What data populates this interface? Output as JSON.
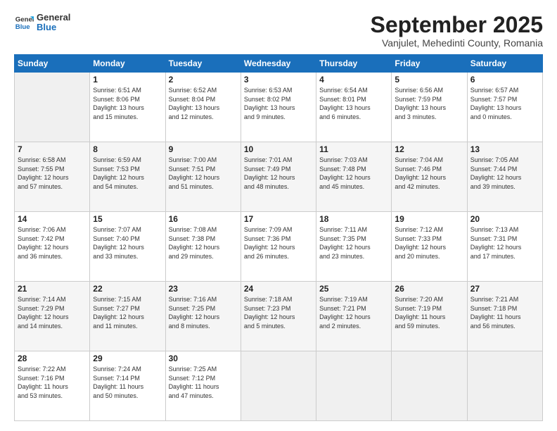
{
  "header": {
    "logo_line1": "General",
    "logo_line2": "Blue",
    "month": "September 2025",
    "location": "Vanjulet, Mehedinti County, Romania"
  },
  "days_of_week": [
    "Sunday",
    "Monday",
    "Tuesday",
    "Wednesday",
    "Thursday",
    "Friday",
    "Saturday"
  ],
  "weeks": [
    [
      {
        "day": "",
        "info": ""
      },
      {
        "day": "1",
        "info": "Sunrise: 6:51 AM\nSunset: 8:06 PM\nDaylight: 13 hours\nand 15 minutes."
      },
      {
        "day": "2",
        "info": "Sunrise: 6:52 AM\nSunset: 8:04 PM\nDaylight: 13 hours\nand 12 minutes."
      },
      {
        "day": "3",
        "info": "Sunrise: 6:53 AM\nSunset: 8:02 PM\nDaylight: 13 hours\nand 9 minutes."
      },
      {
        "day": "4",
        "info": "Sunrise: 6:54 AM\nSunset: 8:01 PM\nDaylight: 13 hours\nand 6 minutes."
      },
      {
        "day": "5",
        "info": "Sunrise: 6:56 AM\nSunset: 7:59 PM\nDaylight: 13 hours\nand 3 minutes."
      },
      {
        "day": "6",
        "info": "Sunrise: 6:57 AM\nSunset: 7:57 PM\nDaylight: 13 hours\nand 0 minutes."
      }
    ],
    [
      {
        "day": "7",
        "info": "Sunrise: 6:58 AM\nSunset: 7:55 PM\nDaylight: 12 hours\nand 57 minutes."
      },
      {
        "day": "8",
        "info": "Sunrise: 6:59 AM\nSunset: 7:53 PM\nDaylight: 12 hours\nand 54 minutes."
      },
      {
        "day": "9",
        "info": "Sunrise: 7:00 AM\nSunset: 7:51 PM\nDaylight: 12 hours\nand 51 minutes."
      },
      {
        "day": "10",
        "info": "Sunrise: 7:01 AM\nSunset: 7:49 PM\nDaylight: 12 hours\nand 48 minutes."
      },
      {
        "day": "11",
        "info": "Sunrise: 7:03 AM\nSunset: 7:48 PM\nDaylight: 12 hours\nand 45 minutes."
      },
      {
        "day": "12",
        "info": "Sunrise: 7:04 AM\nSunset: 7:46 PM\nDaylight: 12 hours\nand 42 minutes."
      },
      {
        "day": "13",
        "info": "Sunrise: 7:05 AM\nSunset: 7:44 PM\nDaylight: 12 hours\nand 39 minutes."
      }
    ],
    [
      {
        "day": "14",
        "info": "Sunrise: 7:06 AM\nSunset: 7:42 PM\nDaylight: 12 hours\nand 36 minutes."
      },
      {
        "day": "15",
        "info": "Sunrise: 7:07 AM\nSunset: 7:40 PM\nDaylight: 12 hours\nand 33 minutes."
      },
      {
        "day": "16",
        "info": "Sunrise: 7:08 AM\nSunset: 7:38 PM\nDaylight: 12 hours\nand 29 minutes."
      },
      {
        "day": "17",
        "info": "Sunrise: 7:09 AM\nSunset: 7:36 PM\nDaylight: 12 hours\nand 26 minutes."
      },
      {
        "day": "18",
        "info": "Sunrise: 7:11 AM\nSunset: 7:35 PM\nDaylight: 12 hours\nand 23 minutes."
      },
      {
        "day": "19",
        "info": "Sunrise: 7:12 AM\nSunset: 7:33 PM\nDaylight: 12 hours\nand 20 minutes."
      },
      {
        "day": "20",
        "info": "Sunrise: 7:13 AM\nSunset: 7:31 PM\nDaylight: 12 hours\nand 17 minutes."
      }
    ],
    [
      {
        "day": "21",
        "info": "Sunrise: 7:14 AM\nSunset: 7:29 PM\nDaylight: 12 hours\nand 14 minutes."
      },
      {
        "day": "22",
        "info": "Sunrise: 7:15 AM\nSunset: 7:27 PM\nDaylight: 12 hours\nand 11 minutes."
      },
      {
        "day": "23",
        "info": "Sunrise: 7:16 AM\nSunset: 7:25 PM\nDaylight: 12 hours\nand 8 minutes."
      },
      {
        "day": "24",
        "info": "Sunrise: 7:18 AM\nSunset: 7:23 PM\nDaylight: 12 hours\nand 5 minutes."
      },
      {
        "day": "25",
        "info": "Sunrise: 7:19 AM\nSunset: 7:21 PM\nDaylight: 12 hours\nand 2 minutes."
      },
      {
        "day": "26",
        "info": "Sunrise: 7:20 AM\nSunset: 7:19 PM\nDaylight: 11 hours\nand 59 minutes."
      },
      {
        "day": "27",
        "info": "Sunrise: 7:21 AM\nSunset: 7:18 PM\nDaylight: 11 hours\nand 56 minutes."
      }
    ],
    [
      {
        "day": "28",
        "info": "Sunrise: 7:22 AM\nSunset: 7:16 PM\nDaylight: 11 hours\nand 53 minutes."
      },
      {
        "day": "29",
        "info": "Sunrise: 7:24 AM\nSunset: 7:14 PM\nDaylight: 11 hours\nand 50 minutes."
      },
      {
        "day": "30",
        "info": "Sunrise: 7:25 AM\nSunset: 7:12 PM\nDaylight: 11 hours\nand 47 minutes."
      },
      {
        "day": "",
        "info": ""
      },
      {
        "day": "",
        "info": ""
      },
      {
        "day": "",
        "info": ""
      },
      {
        "day": "",
        "info": ""
      }
    ]
  ]
}
